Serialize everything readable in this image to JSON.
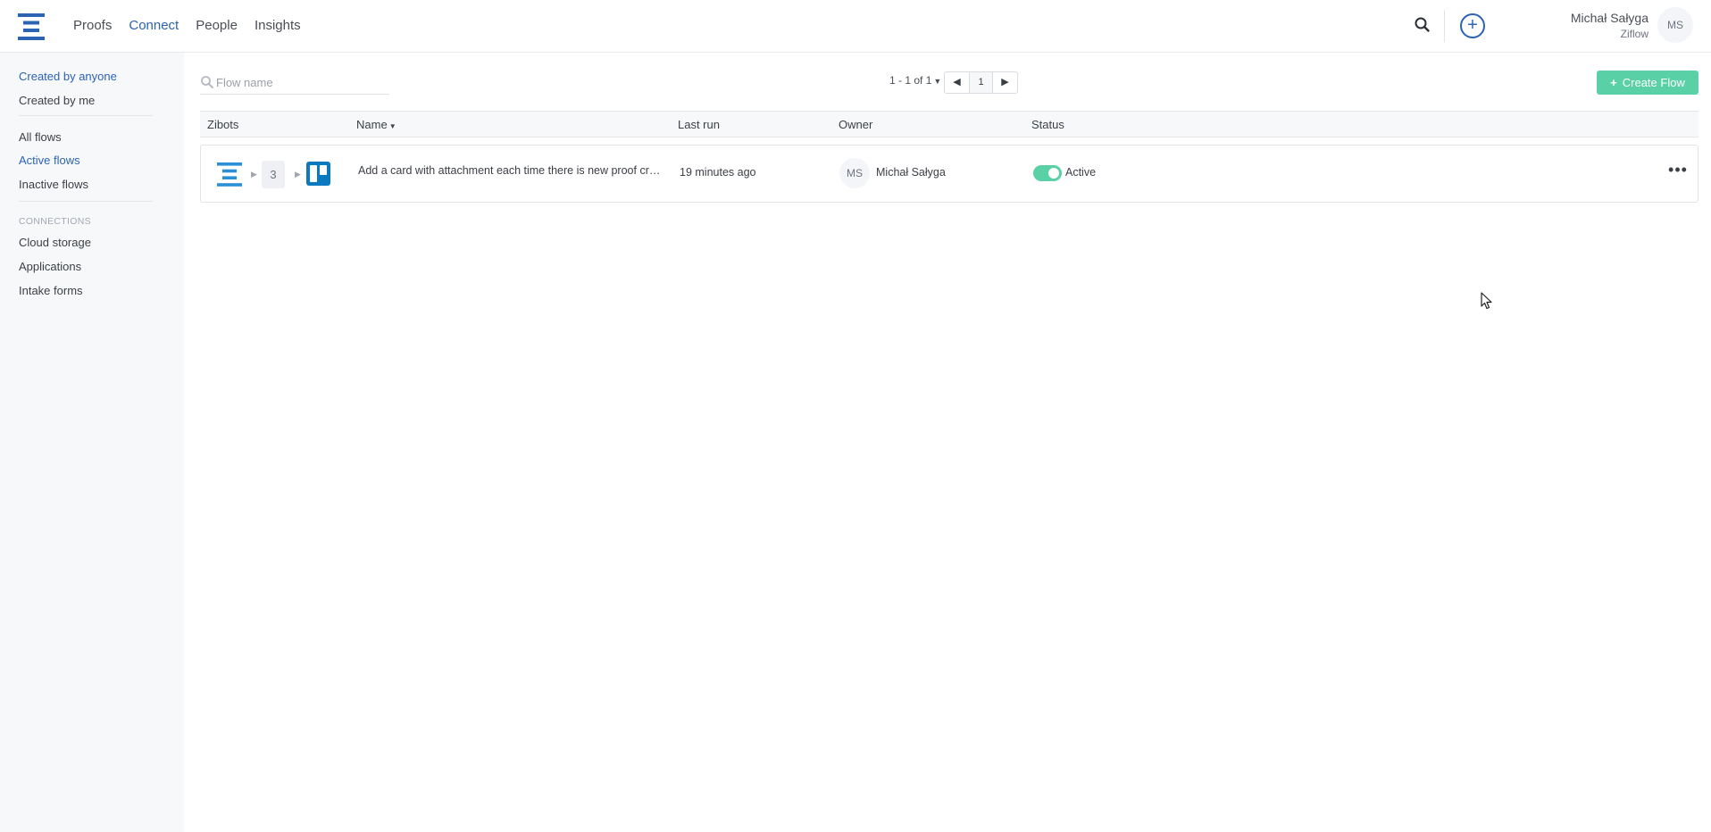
{
  "nav": {
    "items": [
      {
        "label": "Proofs",
        "active": false
      },
      {
        "label": "Connect",
        "active": true
      },
      {
        "label": "People",
        "active": false
      },
      {
        "label": "Insights",
        "active": false
      }
    ]
  },
  "user": {
    "name": "Michał Sałyga",
    "org": "Ziflow",
    "initials": "MS"
  },
  "sidebar": {
    "creator_filters": [
      {
        "label": "Created by anyone",
        "active": true
      },
      {
        "label": "Created by me",
        "active": false
      }
    ],
    "status_filters": [
      {
        "label": "All flows",
        "active": false
      },
      {
        "label": "Active flows",
        "active": true
      },
      {
        "label": "Inactive flows",
        "active": false
      }
    ],
    "connections_heading": "CONNECTIONS",
    "connections": [
      {
        "label": "Cloud storage"
      },
      {
        "label": "Applications"
      },
      {
        "label": "Intake forms"
      }
    ]
  },
  "search": {
    "placeholder": "Flow name",
    "value": ""
  },
  "pagination": {
    "range_text": "1 - 1 of 1",
    "current_page": "1"
  },
  "create_button": {
    "label": "Create Flow"
  },
  "table": {
    "columns": [
      "Zibots",
      "Name",
      "Last run",
      "Owner",
      "Status"
    ],
    "rows": [
      {
        "zibot_steps": "3",
        "name": "Add a card with attachment each time there is new proof created",
        "last_run": "19 minutes ago",
        "owner_initials": "MS",
        "owner_name": "Michał Sałyga",
        "status": "Active",
        "status_on": true
      }
    ]
  },
  "colors": {
    "accent": "#2c63b5",
    "success": "#5ad0a6",
    "trello": "#0b79bf"
  }
}
